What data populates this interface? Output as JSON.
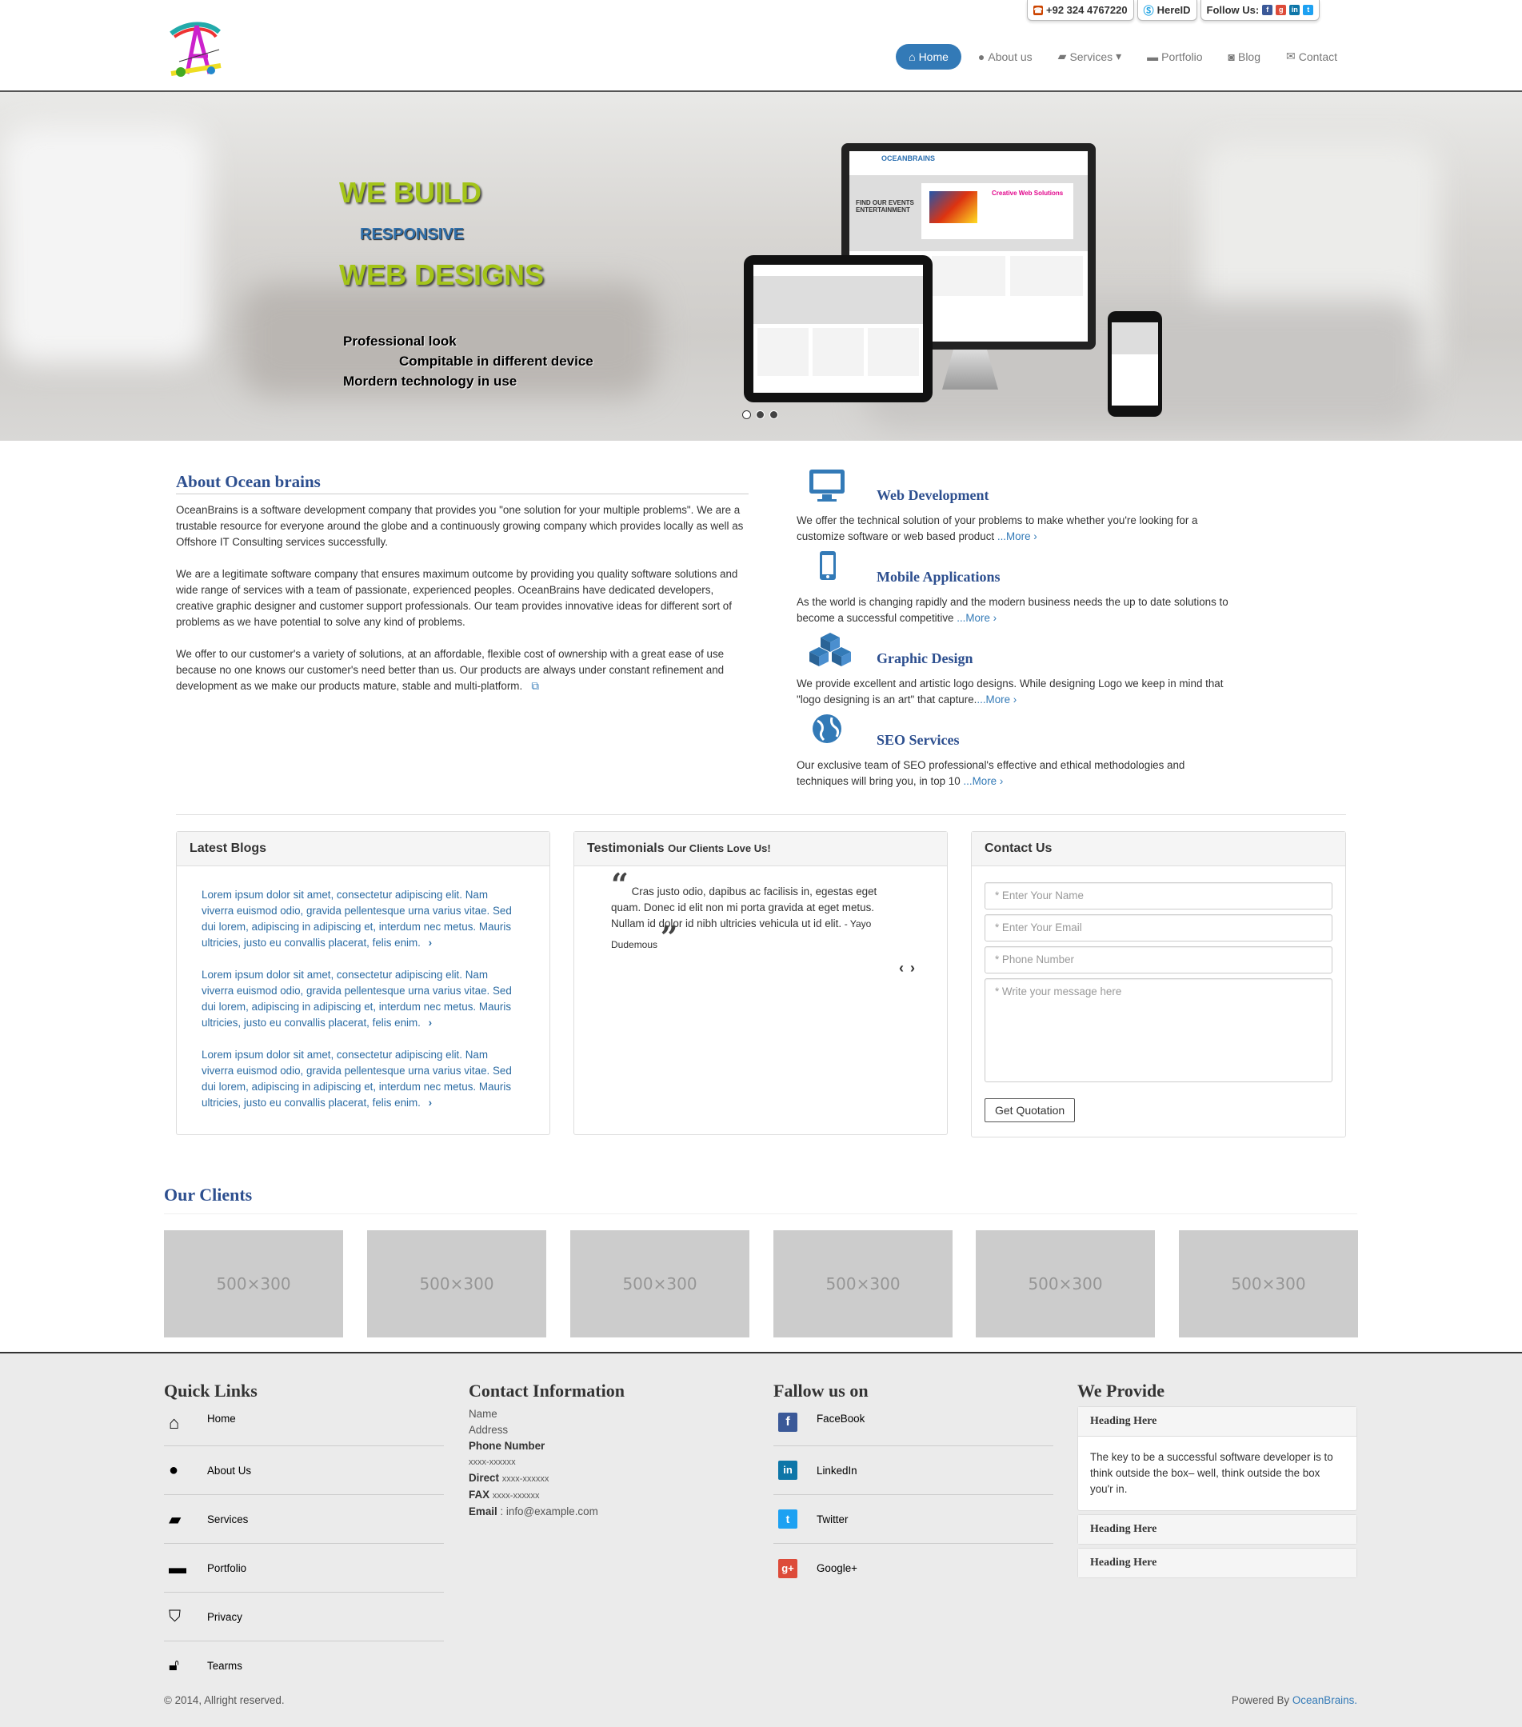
{
  "topbar": {
    "phone": "+92 324 4767220",
    "skype": "HereID",
    "follow_label": "Follow Us:"
  },
  "nav": {
    "home": "Home",
    "about": "About us",
    "services": "Services",
    "portfolio": "Portfolio",
    "blog": "Blog",
    "contact": "Contact"
  },
  "hero": {
    "line1": "WE BUILD",
    "line2": "RESPONSIVE",
    "line3": "WEB DESIGNS",
    "f1": "Professional look",
    "f2": "Compitable in different device",
    "f3": "Mordern technology in use",
    "mock_brand": "OCEANBRAINS",
    "mock_events": "FIND OUR EVENTS ENTERTAINMENT",
    "mock_creative": "Creative Web Solutions"
  },
  "about": {
    "title": "About Ocean brains",
    "p1": "OceanBrains is a software development company that provides you \"one solution for your multiple problems\". We are a trustable resource for everyone around the globe and a continuously growing company which provides locally as well as Offshore IT Consulting services successfully.",
    "p2": "We are a legitimate software company that ensures maximum outcome by providing you quality software solutions and wide range of services with a team of passionate, experienced peoples. OceanBrains have dedicated developers, creative graphic designer and customer support professionals. Our team provides innovative ideas for different sort of problems as we have potential to solve any kind of problems.",
    "p3": "We offer to our customer's a variety of solutions, at an affordable, flexible cost of ownership with a great ease of use because no one knows our customer's need better than us. Our products are always under constant refinement and development as we make our products mature, stable and multi-platform."
  },
  "services": [
    {
      "title": "Web Development",
      "text": "We offer the technical solution of your problems to make whether you're looking for a customize software or web based product",
      "more": "...More ›",
      "icon": "desktop-icon"
    },
    {
      "title": "Mobile Applications",
      "text": "As the world is changing rapidly and the modern business needs the up to date solutions to become a successful competitive",
      "more": "...More ›",
      "icon": "mobile-icon"
    },
    {
      "title": "Graphic Design",
      "text": "We provide excellent and artistic logo designs. While designing Logo we keep in mind that \"logo designing is an art\" that capture.",
      "more": "...More ›",
      "icon": "cubes-icon"
    },
    {
      "title": "SEO Services",
      "text": "Our exclusive team of SEO professional's effective and ethical methodologies and techniques will bring you, in top 10",
      "more": "...More ›",
      "icon": "globe-icon"
    }
  ],
  "blogs": {
    "title": "Latest Blogs",
    "items": [
      "Lorem ipsum dolor sit amet, consectetur adipiscing elit. Nam viverra euismod odio, gravida pellentesque urna varius vitae. Sed dui lorem, adipiscing in adipiscing et, interdum nec metus. Mauris ultricies, justo eu convallis placerat, felis enim.",
      "Lorem ipsum dolor sit amet, consectetur adipiscing elit. Nam viverra euismod odio, gravida pellentesque urna varius vitae. Sed dui lorem, adipiscing in adipiscing et, interdum nec metus. Mauris ultricies, justo eu convallis placerat, felis enim.",
      "Lorem ipsum dolor sit amet, consectetur adipiscing elit. Nam viverra euismod odio, gravida pellentesque urna varius vitae. Sed dui lorem, adipiscing in adipiscing et, interdum nec metus. Mauris ultricies, justo eu convallis placerat, felis enim."
    ]
  },
  "testimonials": {
    "title": "Testimonials",
    "subtitle": "Our Clients Love Us!",
    "quote": "Cras justo odio, dapibus ac facilisis in, egestas eget quam. Donec id elit non mi porta gravida at eget metus. Nullam id dolor id nibh ultricies vehicula ut id elit.",
    "author": "- Yayo Dudemous"
  },
  "contact": {
    "title": "Contact Us",
    "name_ph": "* Enter Your Name",
    "email_ph": "* Enter Your Email",
    "phone_ph": "* Phone Number",
    "msg_ph": "* Write your message here",
    "submit": "Get Quotation"
  },
  "clients": {
    "title": "Our Clients",
    "placeholder": "500×300"
  },
  "footer": {
    "quick_title": "Quick Links",
    "quick": [
      "Home",
      "About Us",
      "Services",
      "Portfolio",
      "Privacy",
      "Tearms"
    ],
    "contact_title": "Contact Information",
    "name": "Name",
    "address": "Address",
    "phone_label": "Phone Number",
    "phone": "xxxx-xxxxxx",
    "direct_label": "Direct",
    "direct": "xxxx-xxxxxx",
    "fax_label": "FAX",
    "fax": "xxxx-xxxxxx",
    "email_label": "Email",
    "email": ": info@example.com",
    "follow_title": "Fallow us on",
    "social": [
      "FaceBook",
      "LinkedIn",
      "Twitter",
      "Google+"
    ],
    "provide_title": "We Provide",
    "acc1": "Heading Here",
    "acc1_body": "The key to be a successful software developer is to think outside the box– well, think outside the box you'r in.",
    "acc2": "Heading Here",
    "acc3": "Heading Here",
    "copyright": "© 2014, Allright reserved.",
    "powered": "Powered By",
    "powered_link": "OceanBrains."
  }
}
